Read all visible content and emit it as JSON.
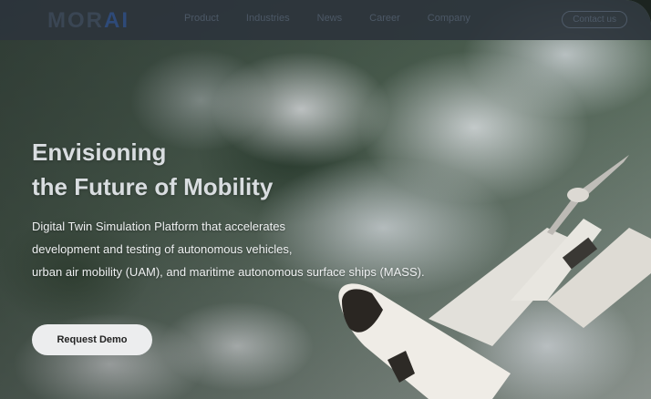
{
  "header": {
    "logo_mor": "MOR",
    "logo_ai": "AI",
    "nav": [
      {
        "label": "Product"
      },
      {
        "label": "Industries"
      },
      {
        "label": "News"
      },
      {
        "label": "Career"
      },
      {
        "label": "Company"
      }
    ],
    "contact_label": "Contact us"
  },
  "hero": {
    "title_line1": "Envisioning",
    "title_line2": "the Future of Mobility",
    "desc_line1": "Digital Twin Simulation Platform that accelerates",
    "desc_line2": "development and testing of autonomous vehicles,",
    "desc_line3": "urban air mobility (UAM), and maritime autonomous surface ships (MASS).",
    "cta_label": "Request Demo"
  },
  "colors": {
    "header_bg": "#2c343c",
    "logo_ai": "#2e4a78",
    "cta_bg": "#ecedee"
  }
}
